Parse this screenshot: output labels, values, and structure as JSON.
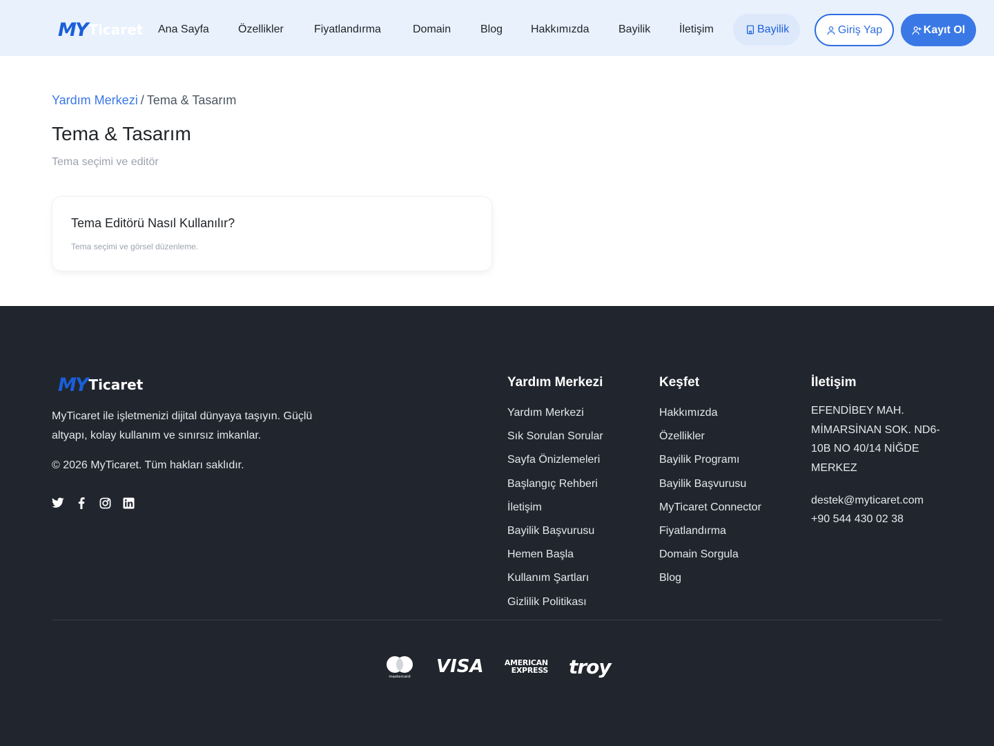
{
  "brand": {
    "logo_primary": "MY",
    "logo_secondary": "Ticaret",
    "accent_color": "#3a78e6",
    "logo_color": "#1a5fd8"
  },
  "header": {
    "nav": [
      {
        "label": "Ana Sayfa"
      },
      {
        "label": "Özellikler"
      },
      {
        "label": "Fiyatlandırma"
      },
      {
        "label": "Domain"
      },
      {
        "label": "Blog"
      },
      {
        "label": "Hakkımızda"
      },
      {
        "label": "Bayilik"
      },
      {
        "label": "İletişim"
      }
    ],
    "pill": {
      "label": "Bayilik",
      "icon": "building-icon"
    },
    "login": {
      "label": "Giriş Yap",
      "icon": "user-icon"
    },
    "register": {
      "label": "Kayıt Ol",
      "icon": "user-plus-icon"
    }
  },
  "main": {
    "breadcrumb": {
      "parent": "Yardım Merkezi",
      "separator": "/",
      "current": "Tema & Tasarım"
    },
    "title": "Tema & Tasarım",
    "subtitle": "Tema seçimi ve editör",
    "articles": [
      {
        "title": "Tema Editörü Nasıl Kullanılır?",
        "description": "Tema seçimi ve görsel düzenleme."
      }
    ]
  },
  "footer": {
    "about": "MyTicaret ile işletmenizi dijital dünyaya taşıyın. Güçlü altyapı, kolay kullanım ve sınırsız imkanlar.",
    "copyright": "© 2026 MyTicaret. Tüm hakları saklıdır.",
    "socials": [
      "twitter-icon",
      "facebook-icon",
      "instagram-icon",
      "linkedin-icon"
    ],
    "columns": {
      "help": {
        "title": "Yardım Merkezi",
        "links": [
          "Yardım Merkezi",
          "Sık Sorulan Sorular",
          "Sayfa Önizlemeleri",
          "Başlangıç Rehberi",
          "İletişim",
          "Bayilik Başvurusu",
          "Hemen Başla",
          "Kullanım Şartları",
          "Gizlilik Politikası"
        ]
      },
      "explore": {
        "title": "Keşfet",
        "links": [
          "Hakkımızda",
          "Özellikler",
          "Bayilik Programı",
          "Bayilik Başvurusu",
          "MyTicaret Connector",
          "Fiyatlandırma",
          "Domain Sorgula",
          "Blog"
        ]
      },
      "contact": {
        "title": "İletişim",
        "address": "EFENDİBEY MAH. MİMARSİNAN SOK. ND6-10B NO 40/14 NİĞDE MERKEZ",
        "email": "destek@myticaret.com",
        "phone": "+90 544 430 02 38"
      }
    },
    "payments": {
      "mastercard_caption": "mastercard",
      "visa": "VISA",
      "amex_line1": "AMERICAN",
      "amex_line2": "EXPRESS",
      "troy": "troy"
    }
  }
}
